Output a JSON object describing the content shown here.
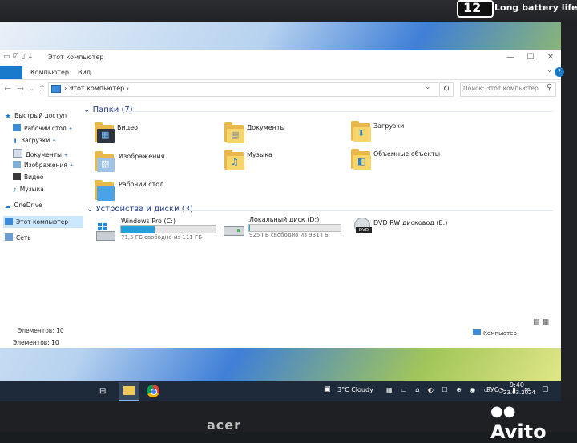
{
  "top_badge": {
    "number": "12",
    "text": "Long battery life"
  },
  "window": {
    "title": "Этот компьютер",
    "ribbon_tabs": [
      "Компьютер",
      "Вид"
    ],
    "address": "Этот компьютер",
    "search_placeholder": "Поиск: Этот компьютер"
  },
  "sidebar": {
    "quick_access": "Быстрый доступ",
    "items": [
      "Рабочий стол",
      "Загрузки",
      "Документы",
      "Изображения",
      "Видео",
      "Музыка"
    ],
    "onedrive": "OneDrive",
    "this_pc": "Этот компьютер",
    "network": "Сеть"
  },
  "folders": {
    "header": "Папки (7)",
    "items": [
      "Видео",
      "Документы",
      "Загрузки",
      "Изображения",
      "Музыка",
      "Объемные объекты",
      "Рабочий стол"
    ]
  },
  "devices": {
    "header": "Устройства и диски (3)",
    "drives": [
      {
        "name": "Windows Pro  (C:)",
        "free": "71,5 ГБ свободно из 111 ГБ",
        "used_fraction": 0.36
      },
      {
        "name": "Локальный диск (D:)",
        "free": "925 ГБ свободно из 931 ГБ",
        "used_fraction": 0.01
      },
      {
        "name": "DVD RW дисковод (E:)",
        "free": ""
      }
    ],
    "dvd_label": "DVD"
  },
  "status": {
    "items_count": "Элементов: 10",
    "location": "Компьютер",
    "lower_items": "Элементов: 10"
  },
  "taskbar": {
    "weather": "3°C  Cloudy",
    "lang": "РУС",
    "time": "9:40",
    "date": "23.03.2024"
  },
  "brand": {
    "laptop": "acer",
    "watermark": "Avito"
  },
  "colors": {
    "accent": "#1979ca",
    "folder": "#f6d56b",
    "drive_bar": "#26a0da"
  }
}
